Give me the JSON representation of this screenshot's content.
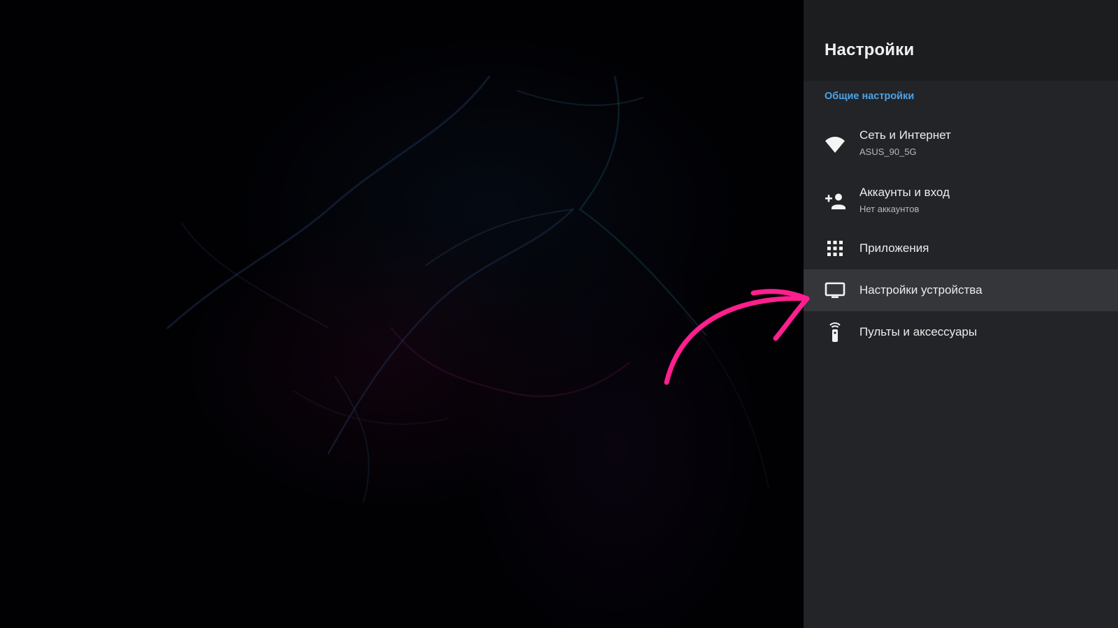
{
  "panel": {
    "title": "Настройки",
    "section_label": "Общие настройки",
    "accent_color": "#4aa3ea",
    "items": [
      {
        "label": "Сеть и Интернет",
        "subtitle": "ASUS_90_5G",
        "icon": "wifi-icon"
      },
      {
        "label": "Аккаунты и вход",
        "subtitle": "Нет аккаунтов",
        "icon": "add-account-icon"
      },
      {
        "label": "Приложения",
        "icon": "apps-grid-icon"
      },
      {
        "label": "Настройки устройства",
        "icon": "tv-icon",
        "selected": true
      },
      {
        "label": "Пульты и аксессуары",
        "icon": "remote-icon"
      }
    ]
  },
  "annotation": {
    "arrow_color": "#ff1f8e"
  }
}
